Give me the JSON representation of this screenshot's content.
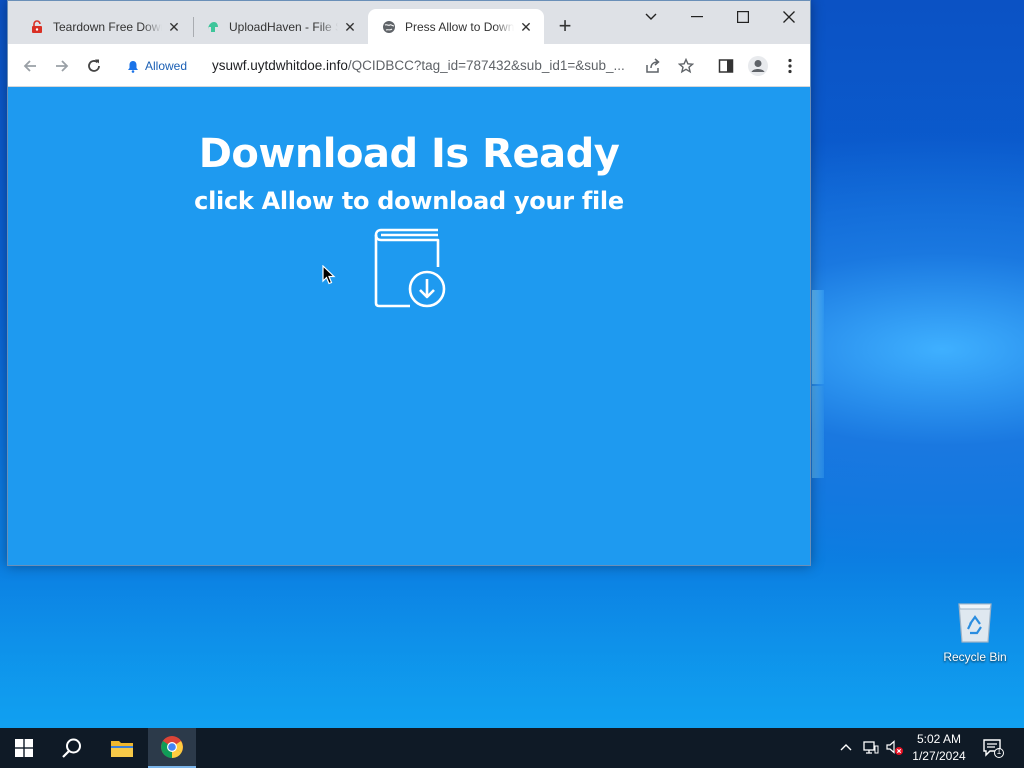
{
  "browser": {
    "tabs": [
      {
        "title": "Teardown Free Download",
        "favicon": "lock-red-icon"
      },
      {
        "title": "UploadHaven - File Sharing",
        "favicon": "uploadhaven-icon"
      },
      {
        "title": "Press Allow to Download",
        "favicon": "globe-icon",
        "active": true
      }
    ],
    "permission_chip": "Allowed",
    "url_host": "ysuwf.uytdwhitdoe.info",
    "url_path": "/QCIDBCC?tag_id=787432&sub_id1=&sub_..."
  },
  "page": {
    "headline": "Download Is Ready",
    "subline": "click Allow to download your file",
    "icon": "book-download-icon",
    "background": "#1e9af0"
  },
  "desktop": {
    "recycle_bin_label": "Recycle Bin"
  },
  "taskbar": {
    "time": "5:02 AM",
    "date": "1/27/2024",
    "notification_count": "1"
  }
}
